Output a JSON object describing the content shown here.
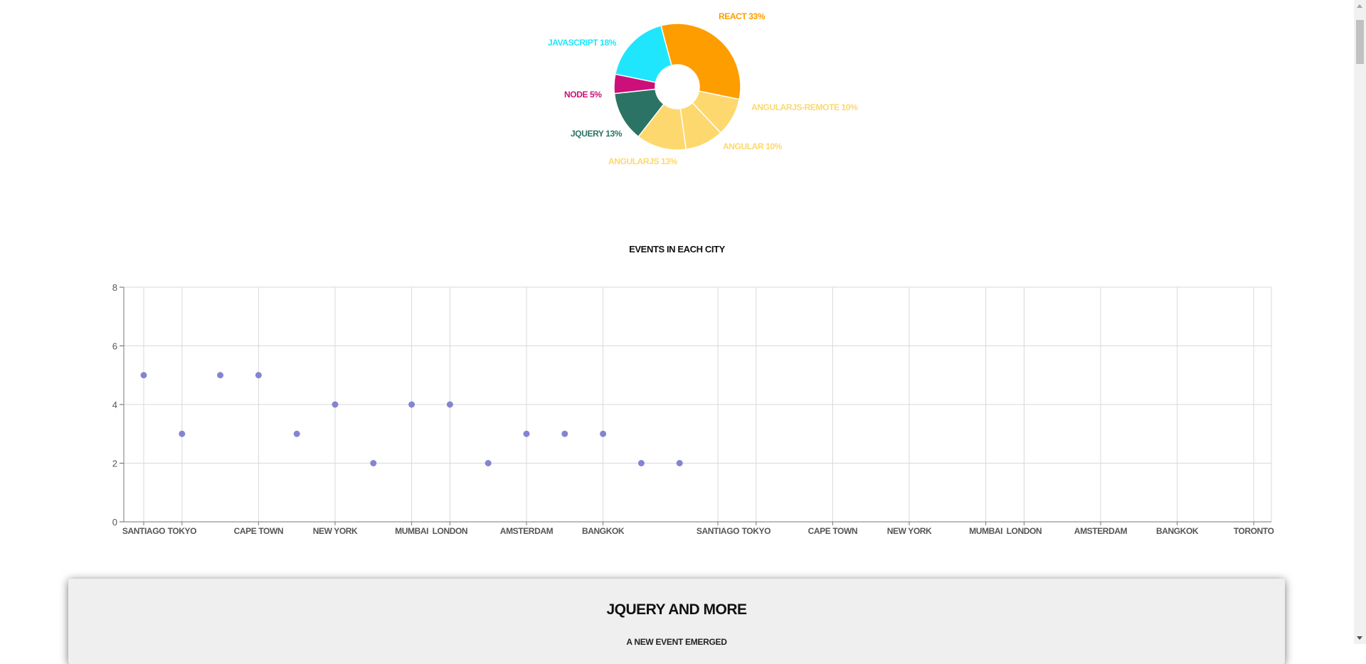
{
  "colors": {
    "react": "#fd9d00",
    "javascript": "#1fe6fd",
    "node": "#cd0f7a",
    "jquery": "#2b7465",
    "angular": "#fdd86e",
    "scatter_point": "#8484d4",
    "grid": "#d9d9d9"
  },
  "chart_data": [
    {
      "type": "pie",
      "title": "",
      "donut": true,
      "slices": [
        {
          "label": "REACT 33%",
          "value": 33,
          "color": "#fd9d00"
        },
        {
          "label": "ANGULARJS-REMOTE 10%",
          "value": 10,
          "color": "#fdd86e"
        },
        {
          "label": "ANGULAR 10%",
          "value": 10,
          "color": "#fdd86e"
        },
        {
          "label": "ANGULARJS 13%",
          "value": 13,
          "color": "#fdd86e"
        },
        {
          "label": "JQUERY 13%",
          "value": 13,
          "color": "#2b7465"
        },
        {
          "label": "NODE 5%",
          "value": 5,
          "color": "#cd0f7a"
        },
        {
          "label": "JAVASCRIPT 18%",
          "value": 18,
          "color": "#1fe6fd"
        }
      ]
    },
    {
      "type": "scatter",
      "title": "EVENTS IN EACH CITY",
      "xlabel": "",
      "ylabel": "",
      "x_tick_labels": [
        "SANTIAGO",
        "TOKYO",
        "CAPE TOWN",
        "NEW YORK",
        "MUMBAI",
        "LONDON",
        "AMSTERDAM",
        "BANGKOK",
        "SANTIAGO",
        "TOKYO",
        "CAPE TOWN",
        "NEW YORK",
        "MUMBAI",
        "LONDON",
        "AMSTERDAM",
        "BANGKOK",
        "TORONTO"
      ],
      "y_ticks": [
        0,
        2,
        4,
        6,
        8
      ],
      "ylim": [
        0,
        8
      ],
      "grid": true,
      "points": [
        5,
        3,
        5,
        5,
        3,
        4,
        2,
        4,
        4,
        2,
        3,
        3,
        3,
        2,
        2
      ]
    }
  ],
  "section_card": {
    "title": "JQUERY AND MORE",
    "subtitle": "A NEW EVENT EMERGED"
  },
  "scrollbar": {
    "thumb_name": "scroll-thumb"
  }
}
